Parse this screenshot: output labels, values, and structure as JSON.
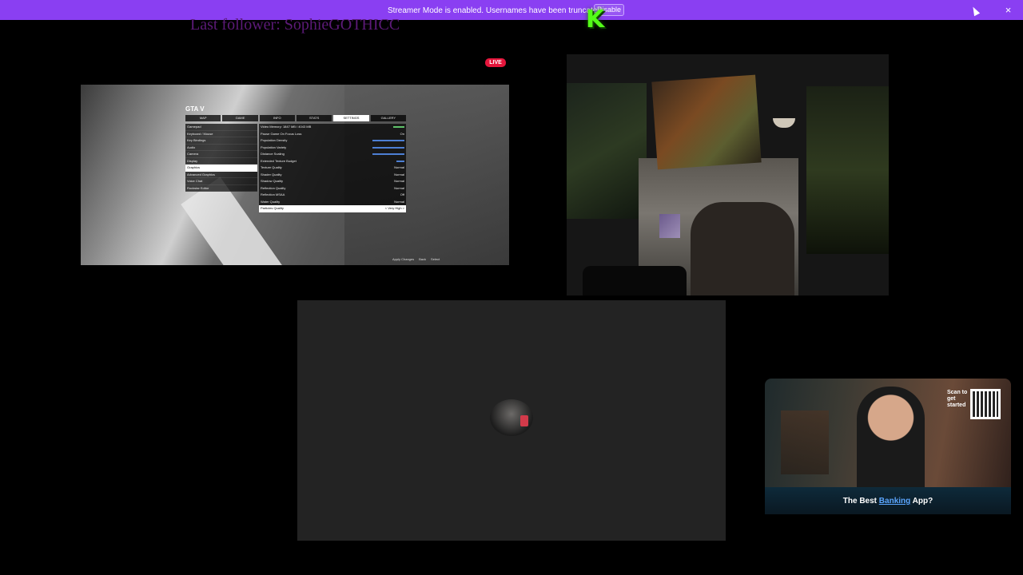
{
  "banner": {
    "message": "Streamer Mode is enabled. Usernames have been truncated.",
    "button_label": "Disable",
    "close_glyph": "×",
    "bg_color": "#8a3ff2"
  },
  "overlay": {
    "follower_text": "Last follower: SophieGOTHICC",
    "live_label": "LIVE",
    "kick_logo_text": "K"
  },
  "game": {
    "logo": "GTA V",
    "tabs": [
      {
        "label": "MAP"
      },
      {
        "label": "GAME"
      },
      {
        "label": "INFO"
      },
      {
        "label": "STATS"
      },
      {
        "label": "SETTINGS"
      },
      {
        "label": "GALLERY"
      }
    ],
    "active_tab": "SETTINGS",
    "menu": [
      {
        "label": "Gamepad"
      },
      {
        "label": "Keyboard / Mouse"
      },
      {
        "label": "Key Bindings"
      },
      {
        "label": "Audio"
      },
      {
        "label": "Camera"
      },
      {
        "label": "Display"
      },
      {
        "label": "Graphics"
      },
      {
        "label": "Advanced Graphics"
      },
      {
        "label": "Voice Chat"
      },
      {
        "label": "Rockstar Editor"
      }
    ],
    "active_menu": "Graphics",
    "settings": [
      {
        "label": "Video Memory: 1847 MB / 4043 MB",
        "value": ""
      },
      {
        "label": "Pause Game On Focus Loss",
        "value": "On"
      },
      {
        "label": "Population Density",
        "value": ""
      },
      {
        "label": "Population Variety",
        "value": ""
      },
      {
        "label": "Distance Scaling",
        "value": ""
      },
      {
        "label": "Extended Texture Budget",
        "value": ""
      },
      {
        "label": "Texture Quality",
        "value": "Normal"
      },
      {
        "label": "Shader Quality",
        "value": "Normal"
      },
      {
        "label": "Shadow Quality",
        "value": "Normal"
      },
      {
        "label": "Reflection Quality",
        "value": "Normal"
      },
      {
        "label": "Reflection MSAA",
        "value": "Off"
      },
      {
        "label": "Water Quality",
        "value": "Normal"
      },
      {
        "label": "Particles Quality",
        "value": "< Very High >"
      }
    ],
    "footer": [
      "Apply Changes",
      "Back",
      "Select"
    ]
  },
  "ad": {
    "scan_text": "Scan to get started",
    "headline_pre": "The Best ",
    "headline_highlight": "Banking",
    "headline_post": " App?",
    "highlight_color": "#5ba6ff"
  },
  "icons": {
    "cursor": "cursor-arrow-icon",
    "close": "close-icon"
  }
}
